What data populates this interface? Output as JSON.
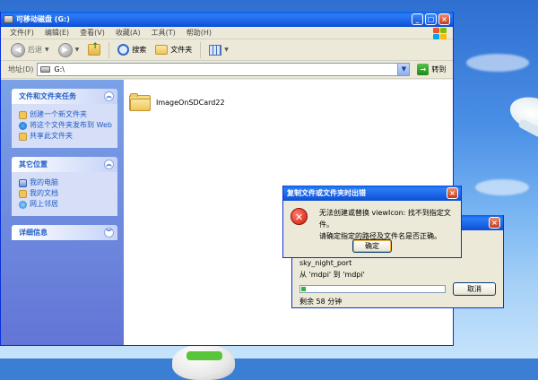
{
  "colors": {
    "xp_blue": "#0b4fd4",
    "task_link": "#215dc6",
    "progress_green": "#36b336",
    "error_red": "#d11b0c"
  },
  "window": {
    "title": "可移动磁盘 (G:)",
    "menu": [
      "文件(F)",
      "编辑(E)",
      "查看(V)",
      "收藏(A)",
      "工具(T)",
      "帮助(H)"
    ],
    "toolbar": {
      "back": "后退",
      "search": "搜索",
      "folders": "文件夹"
    },
    "address": {
      "label": "地址(D)",
      "value": "G:\\",
      "go": "转到"
    }
  },
  "leftpane": {
    "panels": [
      {
        "title": "文件和文件夹任务",
        "items": [
          {
            "label": "创建一个新文件夹",
            "icon": "new-folder-icon"
          },
          {
            "label": "将这个文件夹发布到 Web",
            "icon": "publish-web-icon"
          },
          {
            "label": "共享此文件夹",
            "icon": "share-folder-icon"
          }
        ]
      },
      {
        "title": "其它位置",
        "items": [
          {
            "label": "我的电脑",
            "icon": "my-computer-icon"
          },
          {
            "label": "我的文档",
            "icon": "my-documents-icon"
          },
          {
            "label": "网上邻居",
            "icon": "network-places-icon"
          }
        ]
      },
      {
        "title": "详细信息",
        "items": []
      }
    ]
  },
  "content": {
    "items": [
      {
        "name": "ImageOnSDCard22",
        "icon": "folder-icon"
      }
    ]
  },
  "copy_dialog": {
    "file": "sky_night_port",
    "from_to": "从 'mdpi' 到 'mdpi'",
    "progress": 0.03,
    "remaining": "剩余 58 分钟",
    "cancel": "取消"
  },
  "error_dialog": {
    "title": "复制文件或文件夹时出错",
    "message_line1": "无法创建或替换 viewIcon: 找不到指定文件。",
    "message_line2": "请确定指定的路径及文件名是否正确。",
    "ok": "确定"
  }
}
